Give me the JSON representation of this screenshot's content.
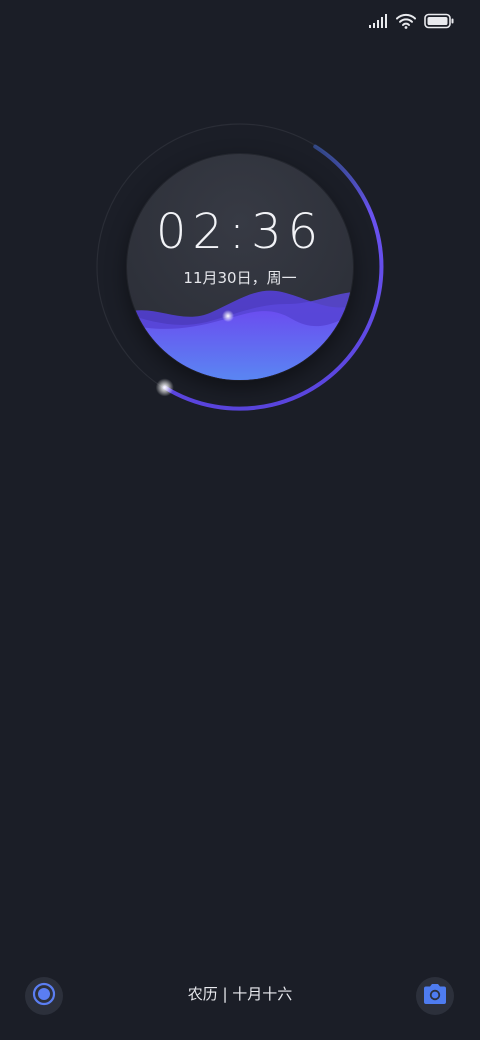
{
  "status_bar": {
    "signal_icon": "signal-bars-icon",
    "wifi_icon": "wifi-icon",
    "battery_icon": "battery-full-icon",
    "battery_level": 1.0
  },
  "clock": {
    "time": "02:36",
    "date": "11月30日，周一",
    "ring_progress": 0.5
  },
  "bottom": {
    "lunar_date": "农历 | 十月十六",
    "left_button_icon": "voice-assistant-icon",
    "right_button_icon": "camera-icon"
  },
  "colors": {
    "background": "#1b1e27",
    "accent": "#6350e6",
    "wave_light": "#5a7ef0"
  }
}
